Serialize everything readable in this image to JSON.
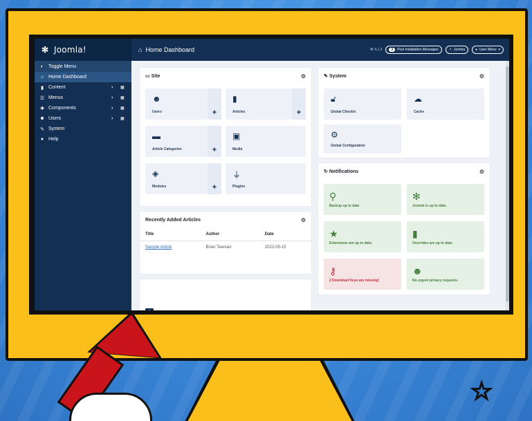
{
  "app": {
    "logo_text": "Joomla!",
    "page_title": "Home Dashboard",
    "version": "⌘ 4.1.2",
    "notification_count": "3",
    "post_install_label": "Post Installation Messages",
    "joomla_link": "Joomla",
    "user_menu": "User Menu"
  },
  "sidebar": {
    "items": [
      {
        "label": "Toggle Menu",
        "icon": "toggle-icon"
      },
      {
        "label": "Home Dashboard",
        "icon": "home-icon"
      },
      {
        "label": "Content",
        "icon": "file-icon"
      },
      {
        "label": "Menus",
        "icon": "list-icon"
      },
      {
        "label": "Components",
        "icon": "puzzle-icon"
      },
      {
        "label": "Users",
        "icon": "users-icon"
      },
      {
        "label": "System",
        "icon": "wrench-icon"
      },
      {
        "label": "Help",
        "icon": "info-icon"
      }
    ]
  },
  "site": {
    "title": "Site",
    "tiles": [
      {
        "label": "Users",
        "icon": "users-icon"
      },
      {
        "label": "Articles",
        "icon": "file-icon"
      },
      {
        "label": "Article Categories",
        "icon": "folder-icon"
      },
      {
        "label": "Media",
        "icon": "image-icon"
      },
      {
        "label": "Modules",
        "icon": "cube-icon"
      },
      {
        "label": "Plugins",
        "icon": "plug-icon"
      }
    ]
  },
  "system": {
    "title": "System",
    "tiles": [
      {
        "label": "Global Checkin",
        "icon": "unlock-icon"
      },
      {
        "label": "Cache",
        "icon": "cloud-icon"
      },
      {
        "label": "Global Configuration",
        "icon": "gear-icon"
      }
    ]
  },
  "notifications": {
    "title": "Notifications",
    "tiles": [
      {
        "label": "Backup up to date",
        "icon": "backup-icon",
        "status": "ok"
      },
      {
        "label": "Joomla is up to date.",
        "icon": "joomla-icon",
        "status": "ok"
      },
      {
        "label": "Extensions are up to date.",
        "icon": "star-icon",
        "status": "ok"
      },
      {
        "label": "Overrides are up to date.",
        "icon": "file-icon",
        "status": "ok"
      },
      {
        "label": "2 Download Keys are missing!",
        "icon": "key-icon",
        "status": "bad"
      },
      {
        "label": "No urgent privacy requests.",
        "icon": "users-icon",
        "status": "ok"
      }
    ]
  },
  "recent": {
    "title": "Recently Added Articles",
    "columns": [
      "Title",
      "Author",
      "Date"
    ],
    "rows": [
      {
        "title": "Sample Article",
        "author": "Brian Teeman",
        "date": "2022-05-15"
      }
    ]
  },
  "colors": {
    "sidebar": "#132f53",
    "monitor": "#fbbf1b",
    "accent_red": "#c8141a"
  }
}
